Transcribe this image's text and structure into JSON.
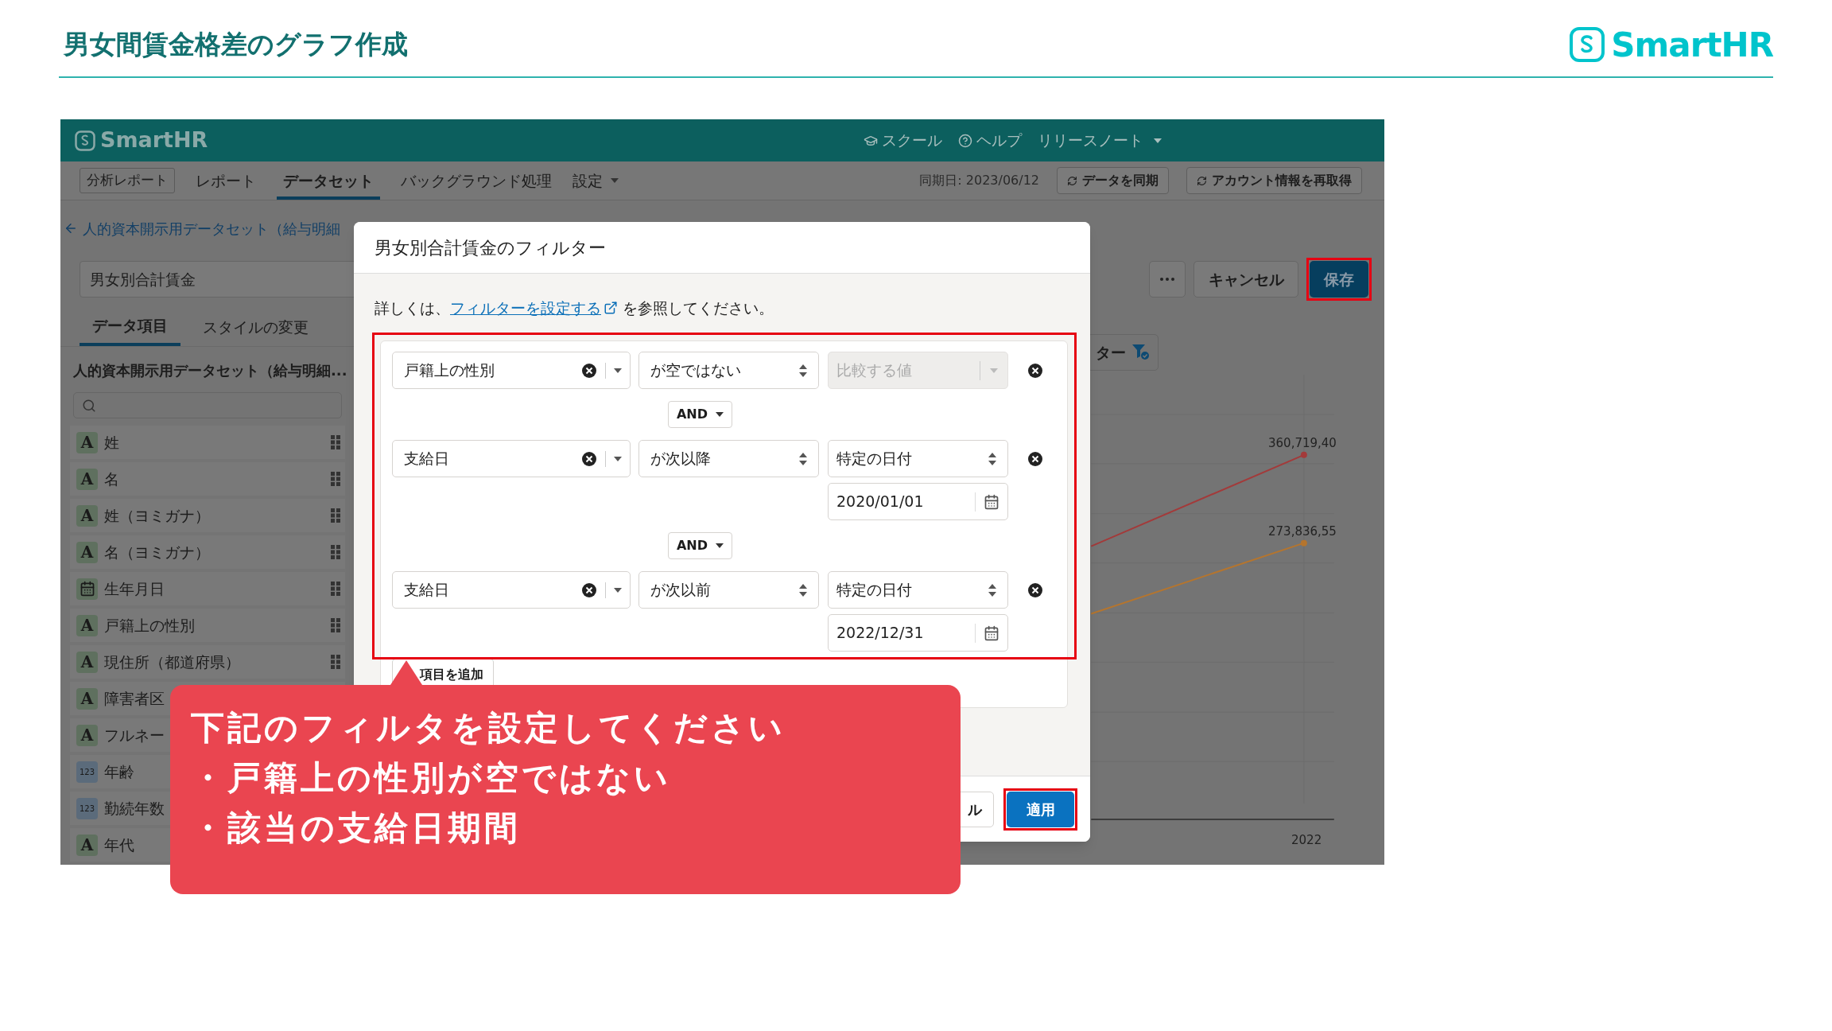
{
  "slide": {
    "title": "男女間賃金格差のグラフ作成",
    "logo": "SmartHR"
  },
  "app": {
    "brand": "SmartHR",
    "top_links": [
      {
        "kind": "school",
        "label": "スクール"
      },
      {
        "kind": "help",
        "label": "ヘルプ"
      },
      {
        "kind": "menu",
        "label": "リリースノート"
      }
    ],
    "nav_tabs": [
      {
        "label": "分析レポート",
        "kind": "boxed",
        "selected": false
      },
      {
        "label": "レポート",
        "kind": "plain",
        "selected": false
      },
      {
        "label": "データセット",
        "kind": "plain",
        "selected": true
      },
      {
        "label": "バックグラウンド処理",
        "kind": "plain",
        "selected": false
      },
      {
        "label": "設定",
        "kind": "menu",
        "selected": false
      }
    ],
    "sync_date": "同期日: 2023/06/12",
    "sync_buttons": [
      "データを同期",
      "アカウント情報を再取得"
    ],
    "back_link": "人的資本開示用データセット（給与明細",
    "name_field": {
      "value": "男女別合計賃金"
    },
    "actions": [
      {
        "kind": "more",
        "highlighted": false
      },
      {
        "kind": "secondary",
        "label": "キャンセル",
        "highlighted": false
      },
      {
        "kind": "primary",
        "label": "保存",
        "highlighted": true
      }
    ],
    "panel_tabs": [
      {
        "label": "データ項目",
        "selected": true
      },
      {
        "label": "スタイルの変更",
        "selected": false
      }
    ],
    "dataset_title": "人的資本開示用データセット（給与明細...",
    "fields": [
      {
        "kind": "text",
        "badge": "A",
        "label": "姓",
        "handle": true
      },
      {
        "kind": "text",
        "badge": "A",
        "label": "名",
        "handle": true
      },
      {
        "kind": "text",
        "badge": "A",
        "label": "姓（ヨミガナ）",
        "handle": true
      },
      {
        "kind": "text",
        "badge": "A",
        "label": "名（ヨミガナ）",
        "handle": true
      },
      {
        "kind": "date",
        "label": "生年月日",
        "handle": true
      },
      {
        "kind": "text",
        "badge": "A",
        "label": "戸籍上の性別",
        "handle": true
      },
      {
        "kind": "text",
        "badge": "A",
        "label": "現住所（都道府県）",
        "handle": true
      },
      {
        "kind": "text",
        "badge": "A",
        "label": "障害者区",
        "handle": false
      },
      {
        "kind": "text",
        "badge": "A",
        "label": "フルネー",
        "handle": false
      },
      {
        "kind": "number",
        "badge": "123",
        "label": "年齢",
        "handle": false
      },
      {
        "kind": "number",
        "badge": "123",
        "label": "勤続年数",
        "handle": false
      },
      {
        "kind": "text",
        "badge": "A",
        "label": "年代",
        "handle": false
      }
    ],
    "filter_button": {
      "label": "ター"
    },
    "chart": {
      "labels": [
        {
          "text": "360,719,40",
          "color": "#a33a3a"
        },
        {
          "text": "273,836,55",
          "color": "#b5752e"
        }
      ],
      "x_label": "2022"
    }
  },
  "dialog": {
    "title": "男女別合計賃金のフィルター",
    "intro_before": "詳しくは、",
    "link": "フィルターを設定する",
    "intro_after": "を参照してください。",
    "highlighted": true,
    "conditions": [
      {
        "field": "戸籍上の性別",
        "operator": "が空ではない",
        "value": {
          "placeholder": "比較する値",
          "disabled": true
        }
      },
      {
        "field": "支給日",
        "operator": "が次以降",
        "value": {
          "text": "特定の日付",
          "disabled": false
        },
        "date": "2020/01/01"
      },
      {
        "field": "支給日",
        "operator": "が次以前",
        "value": {
          "text": "特定の日付",
          "disabled": false
        },
        "date": "2022/12/31"
      }
    ],
    "connectors": [
      "AND",
      "AND"
    ],
    "add_button": "項目を追加",
    "footer_buttons": [
      {
        "kind": "cancel",
        "label": "ル",
        "highlighted": false
      },
      {
        "kind": "apply",
        "label": "適用",
        "highlighted": true
      }
    ]
  },
  "callout": {
    "lines": [
      "下記のフィルタを設定してください",
      "・戸籍上の性別が空ではない",
      "・該当の支給日期間"
    ]
  }
}
